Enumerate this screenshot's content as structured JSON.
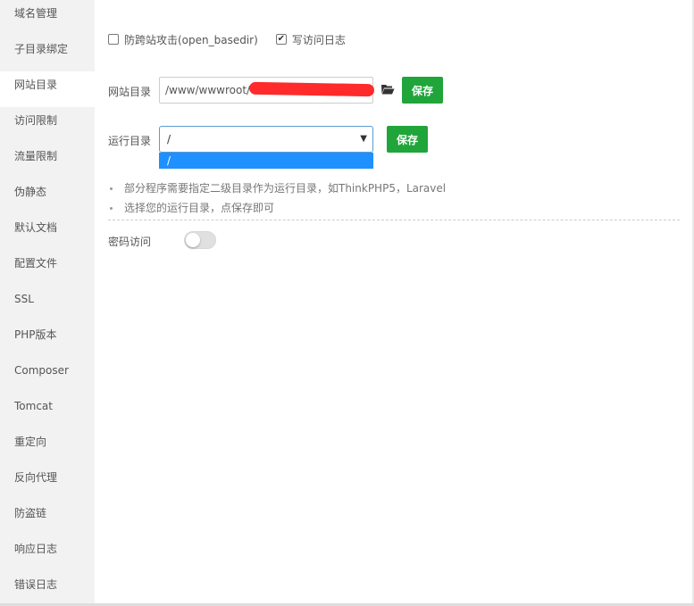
{
  "sidebar": {
    "items": [
      {
        "label": "域名管理"
      },
      {
        "label": "子目录绑定"
      },
      {
        "label": "网站目录"
      },
      {
        "label": "访问限制"
      },
      {
        "label": "流量限制"
      },
      {
        "label": "伪静态"
      },
      {
        "label": "默认文档"
      },
      {
        "label": "配置文件"
      },
      {
        "label": "SSL"
      },
      {
        "label": "PHP版本"
      },
      {
        "label": "Composer"
      },
      {
        "label": "Tomcat"
      },
      {
        "label": "重定向"
      },
      {
        "label": "反向代理"
      },
      {
        "label": "防盗链"
      },
      {
        "label": "响应日志"
      },
      {
        "label": "错误日志"
      }
    ],
    "active_index": 2
  },
  "options": {
    "anti_xss": {
      "label": "防跨站攻击(open_basedir)",
      "checked": false
    },
    "access_log": {
      "label": "写访问日志",
      "checked": true
    }
  },
  "site_dir": {
    "label": "网站目录",
    "value": "/www/wwwroot/",
    "redacted": true,
    "icon": "folder-open-icon",
    "save_label": "保存"
  },
  "run_dir": {
    "label": "运行目录",
    "selected": "/",
    "options": [
      "/"
    ],
    "save_label": "保存"
  },
  "tips": [
    "部分程序需要指定二级目录作为运行目录，如ThinkPHP5，Laravel",
    "选择您的运行目录，点保存即可"
  ],
  "password_access": {
    "label": "密码访问",
    "enabled": false
  },
  "colors": {
    "accent": "#20a53a",
    "dropdown_highlight": "#1e90ff",
    "sidebar_bg": "#f2f2f2"
  }
}
